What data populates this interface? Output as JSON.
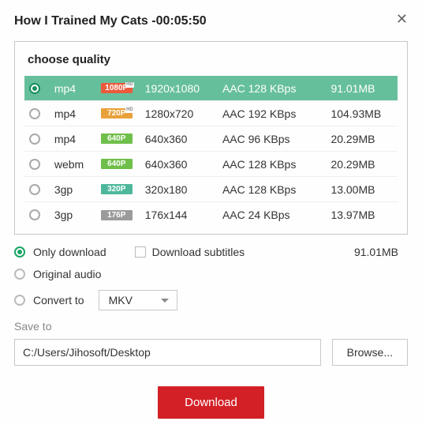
{
  "title": "How I Trained My Cats ",
  "duration": "-00:05:50",
  "quality_title": "choose quality",
  "rows": [
    {
      "fmt": "mp4",
      "badge": "1080P",
      "badgeClass": "badge-1080 hd",
      "res": "1920x1080",
      "audio": "AAC 128 KBps",
      "size": "91.01MB",
      "selected": true
    },
    {
      "fmt": "mp4",
      "badge": "720P",
      "badgeClass": "badge-720 hd",
      "res": "1280x720",
      "audio": "AAC 192 KBps",
      "size": "104.93MB",
      "selected": false
    },
    {
      "fmt": "mp4",
      "badge": "640P",
      "badgeClass": "badge-640",
      "res": "640x360",
      "audio": "AAC 96 KBps",
      "size": "20.29MB",
      "selected": false
    },
    {
      "fmt": "webm",
      "badge": "640P",
      "badgeClass": "badge-640",
      "res": "640x360",
      "audio": "AAC 128 KBps",
      "size": "20.29MB",
      "selected": false
    },
    {
      "fmt": "3gp",
      "badge": "320P",
      "badgeClass": "badge-320",
      "res": "320x180",
      "audio": "AAC 128 KBps",
      "size": "13.00MB",
      "selected": false
    },
    {
      "fmt": "3gp",
      "badge": "176P",
      "badgeClass": "badge-176",
      "res": "176x144",
      "audio": "AAC 24 KBps",
      "size": "13.97MB",
      "selected": false
    }
  ],
  "options": {
    "only_download": "Only download",
    "download_subtitles": "Download subtitles",
    "original_audio": "Original audio",
    "convert_to": "Convert to",
    "convert_value": "MKV",
    "selected_size": "91.01MB"
  },
  "save": {
    "label": "Save to",
    "path": "C:/Users/Jihosoft/Desktop",
    "browse": "Browse..."
  },
  "download": "Download"
}
